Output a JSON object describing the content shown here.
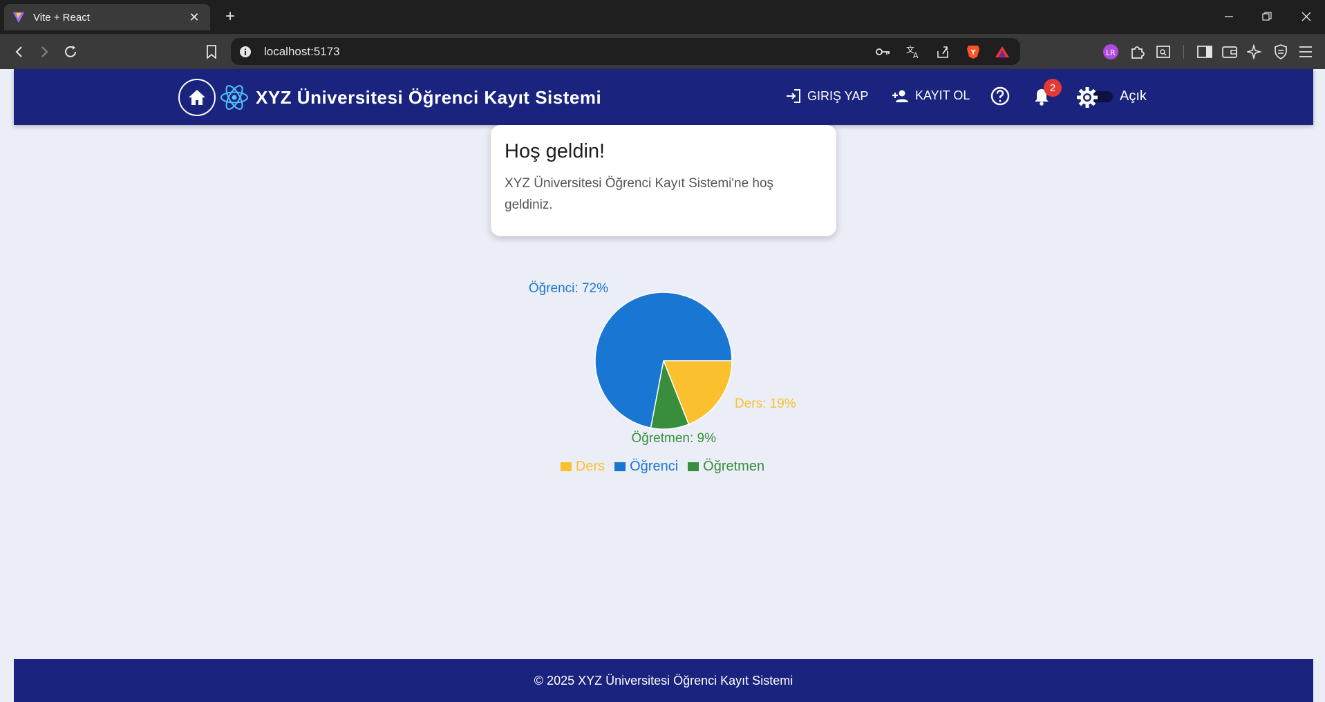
{
  "browser": {
    "tab_title": "Vite + React",
    "url": "localhost:5173"
  },
  "header": {
    "title": "XYZ Üniversitesi Öğrenci Kayıt Sistemi",
    "login_label": "GIRIŞ YAP",
    "register_label": "KAYIT OL",
    "notification_count": "2",
    "theme_label": "Açık"
  },
  "card": {
    "title": "Hoş geldin!",
    "text": "XYZ Üniversitesi Öğrenci Kayıt Sistemi'ne hoş geldiniz."
  },
  "chart_data": {
    "type": "pie",
    "slices": [
      {
        "name": "Ders",
        "value": 19,
        "label": "Ders: 19%",
        "color": "#fbc02d"
      },
      {
        "name": "Öğretmen",
        "value": 9,
        "label": "Öğretmen: 9%",
        "color": "#388e3c"
      },
      {
        "name": "Öğrenci",
        "value": 72,
        "label": "Öğrenci: 72%",
        "color": "#1976d2"
      }
    ],
    "legend": [
      "Ders",
      "Öğrenci",
      "Öğretmen"
    ],
    "legend_placement": "bottom"
  },
  "footer": {
    "text": "© 2025 XYZ Üniversitesi Öğrenci Kayıt Sistemi"
  },
  "colors": {
    "header_bg": "#1a237e",
    "page_bg": "#ebeef6",
    "badge": "#e53935"
  }
}
